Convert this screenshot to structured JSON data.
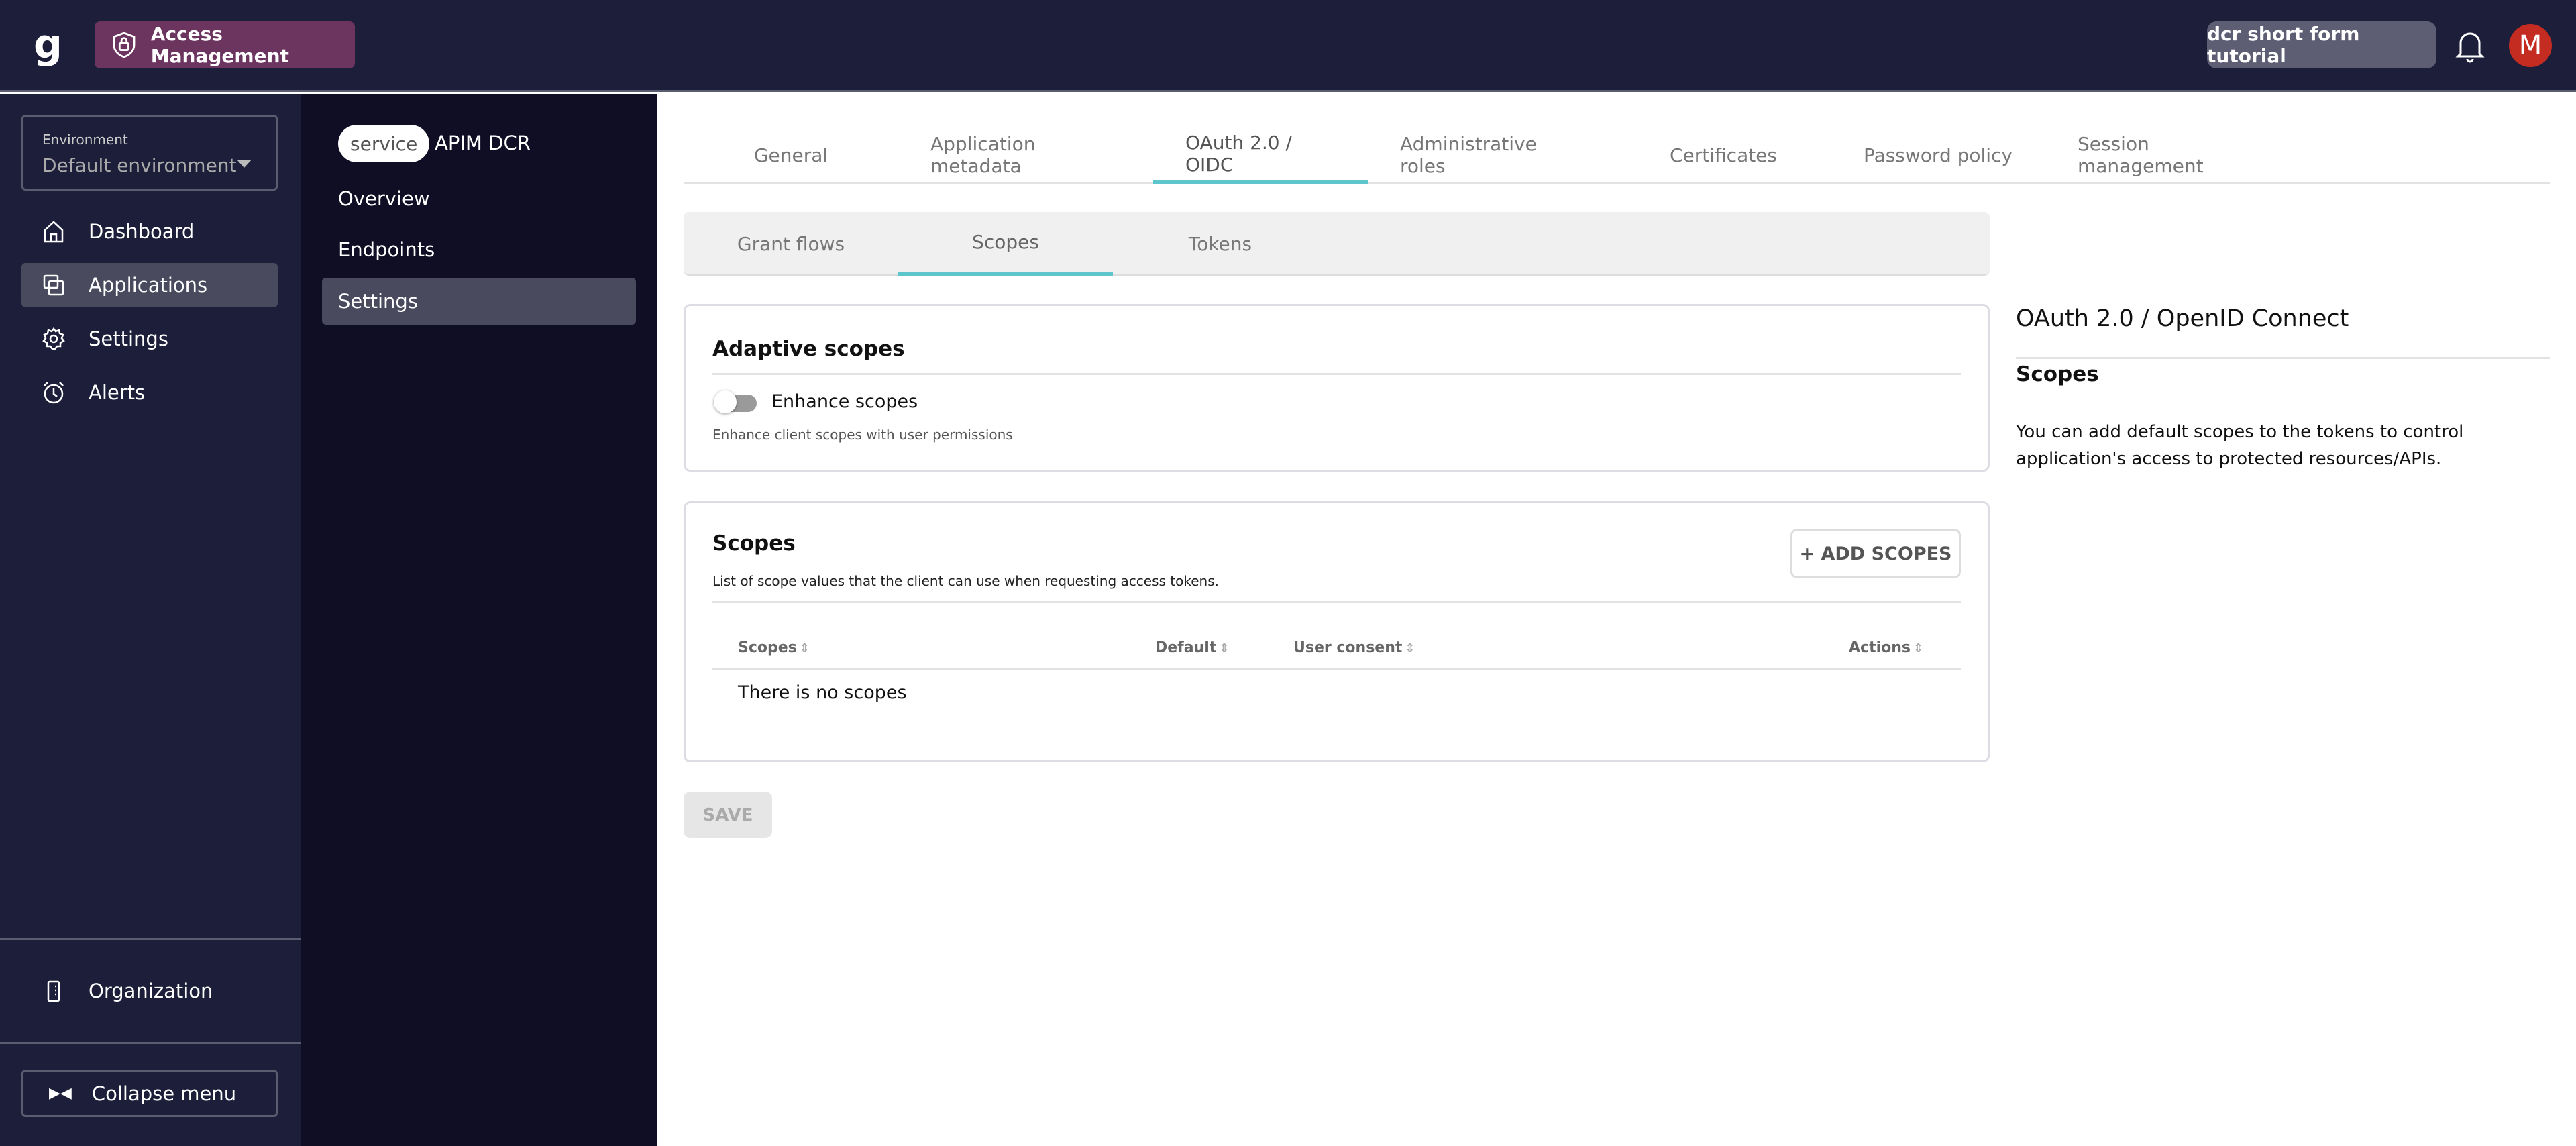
{
  "header": {
    "logo": "g",
    "product": "Access Management",
    "environment_chip": "dcr short form tutorial",
    "avatar_initial": "M",
    "icons": [
      "gravitee-logo-icon",
      "shield-lock-icon",
      "bell-icon"
    ],
    "colors": {
      "topbar": "#1d1f3a",
      "product": "#6b3560",
      "avatar": "#c42b21",
      "accent": "#5dc5cc"
    }
  },
  "sidebar": {
    "environment_label": "Environment",
    "environment_value": "Default environment",
    "items": [
      {
        "label": "Dashboard",
        "icon": "home-icon"
      },
      {
        "label": "Applications",
        "icon": "applications-icon",
        "active": true
      },
      {
        "label": "Settings",
        "icon": "gear-icon"
      },
      {
        "label": "Alerts",
        "icon": "alarm-icon"
      }
    ],
    "organization": "Organization",
    "collapse": "Collapse menu"
  },
  "subnav": {
    "badge": "service",
    "app_name": "APIM DCR",
    "items": [
      "Overview",
      "Endpoints",
      "Settings"
    ],
    "active": "Settings"
  },
  "tabs": [
    "General",
    "Application metadata",
    "OAuth 2.0 / OIDC",
    "Administrative roles",
    "Certificates",
    "Password policy",
    "Session management"
  ],
  "active_tab": "OAuth 2.0 / OIDC",
  "subtabs": [
    "Grant flows",
    "Scopes",
    "Tokens"
  ],
  "active_subtab": "Scopes",
  "adaptive": {
    "title": "Adaptive scopes",
    "toggle_label": "Enhance scopes",
    "toggle_on": false,
    "help": "Enhance client scopes with user permissions"
  },
  "scopes": {
    "title": "Scopes",
    "description": "List of scope values that the client can use when requesting access tokens.",
    "add_button": "+ ADD SCOPES",
    "columns": [
      "Scopes",
      "Default",
      "User consent",
      "Actions"
    ],
    "empty": "There is no scopes"
  },
  "save": "SAVE",
  "help": {
    "title": "OAuth 2.0 / OpenID Connect",
    "subtitle": "Scopes",
    "text": "You can add default scopes to the tokens to control application's access to protected resources/APIs."
  }
}
